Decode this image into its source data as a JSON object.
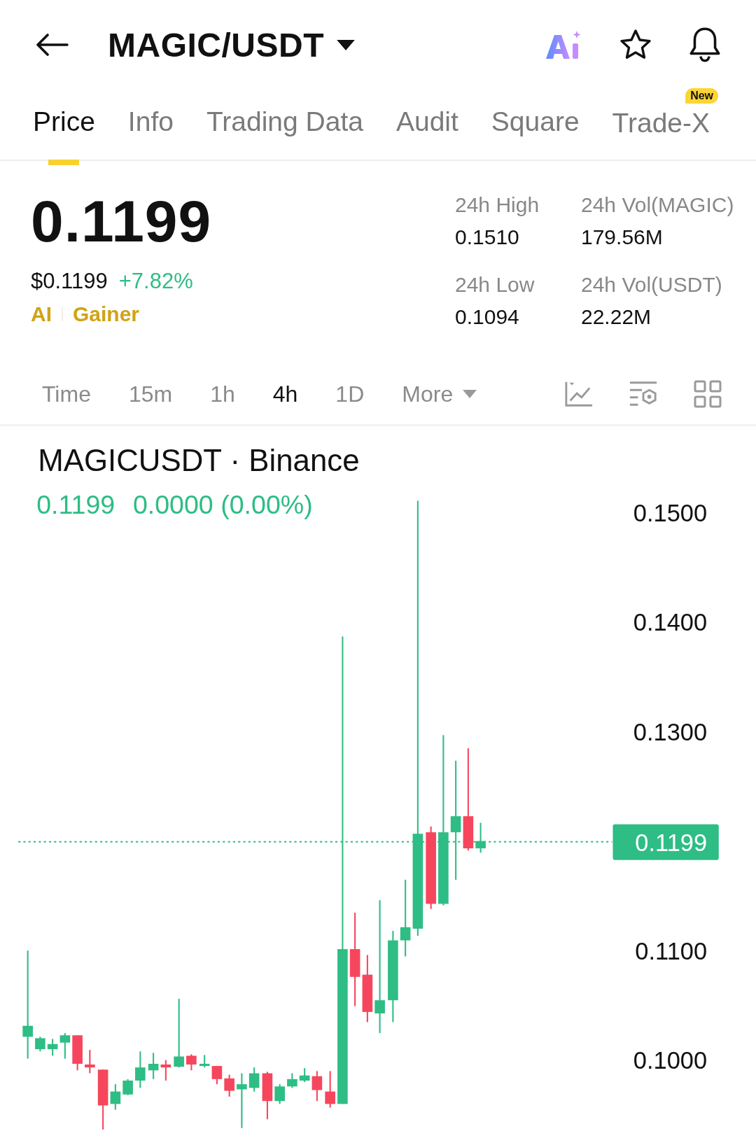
{
  "header": {
    "title": "MAGIC/USDT"
  },
  "tabs": [
    {
      "label": "Price",
      "selected": true
    },
    {
      "label": "Info",
      "selected": false
    },
    {
      "label": "Trading Data",
      "selected": false
    },
    {
      "label": "Audit",
      "selected": false
    },
    {
      "label": "Square",
      "selected": false
    },
    {
      "label": "Trade-X",
      "selected": false,
      "badge": "New"
    }
  ],
  "price": {
    "last": "0.1199",
    "usd": "$0.1199",
    "change": "+7.82%",
    "tags": [
      "AI",
      "Gainer"
    ]
  },
  "stats": [
    {
      "label": "24h High",
      "value": "0.1510"
    },
    {
      "label": "24h Vol(MAGIC)",
      "value": "179.56M"
    },
    {
      "label": "24h Low",
      "value": "0.1094"
    },
    {
      "label": "24h Vol(USDT)",
      "value": "22.22M"
    }
  ],
  "intervals": [
    {
      "label": "Time",
      "selected": false,
      "kind": "option"
    },
    {
      "label": "15m",
      "selected": false,
      "kind": "option"
    },
    {
      "label": "1h",
      "selected": false,
      "kind": "option"
    },
    {
      "label": "4h",
      "selected": true,
      "kind": "option"
    },
    {
      "label": "1D",
      "selected": false,
      "kind": "option"
    },
    {
      "label": "More",
      "selected": false,
      "kind": "dropdown"
    }
  ],
  "chart": {
    "title": "MAGICUSDT · Binance",
    "legend_price": "0.1199",
    "legend_change": "0.0000 (0.00%)",
    "price_labels": [
      "0.1500",
      "0.1400",
      "0.1300",
      "0.1100",
      "0.1000"
    ],
    "current_price": "0.1199"
  }
}
